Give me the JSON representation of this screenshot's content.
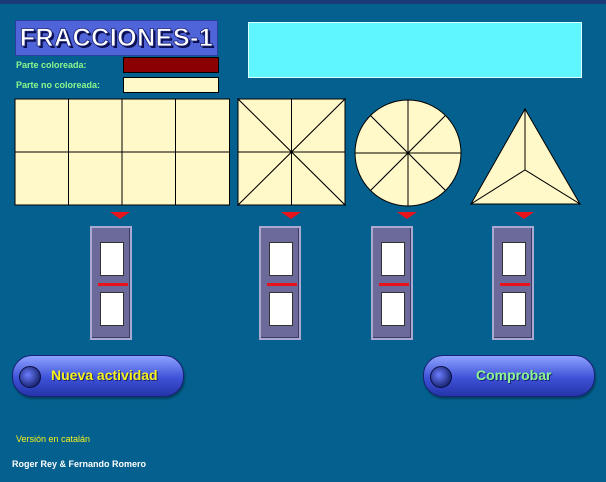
{
  "title": "FRACCIONES-1",
  "legend": {
    "colored_label": "Parte coloreada:",
    "uncolored_label": "Parte no coloreada:",
    "colored_color": "#8b0000",
    "uncolored_color": "#fff8c8"
  },
  "message": "",
  "shapes": [
    {
      "name": "rectangle",
      "parts": 8
    },
    {
      "name": "square-diagonals",
      "parts": 8
    },
    {
      "name": "circle",
      "parts": 8
    },
    {
      "name": "triangle",
      "parts": 3
    }
  ],
  "fractions": [
    {
      "numerator": "",
      "denominator": ""
    },
    {
      "numerator": "",
      "denominator": ""
    },
    {
      "numerator": "",
      "denominator": ""
    },
    {
      "numerator": "",
      "denominator": ""
    }
  ],
  "buttons": {
    "new_activity": "Nueva actividad",
    "check": "Comprobar"
  },
  "footer": {
    "version_link": "Versión en catalán",
    "authors": "Roger Rey  &  Fernando Romero"
  }
}
